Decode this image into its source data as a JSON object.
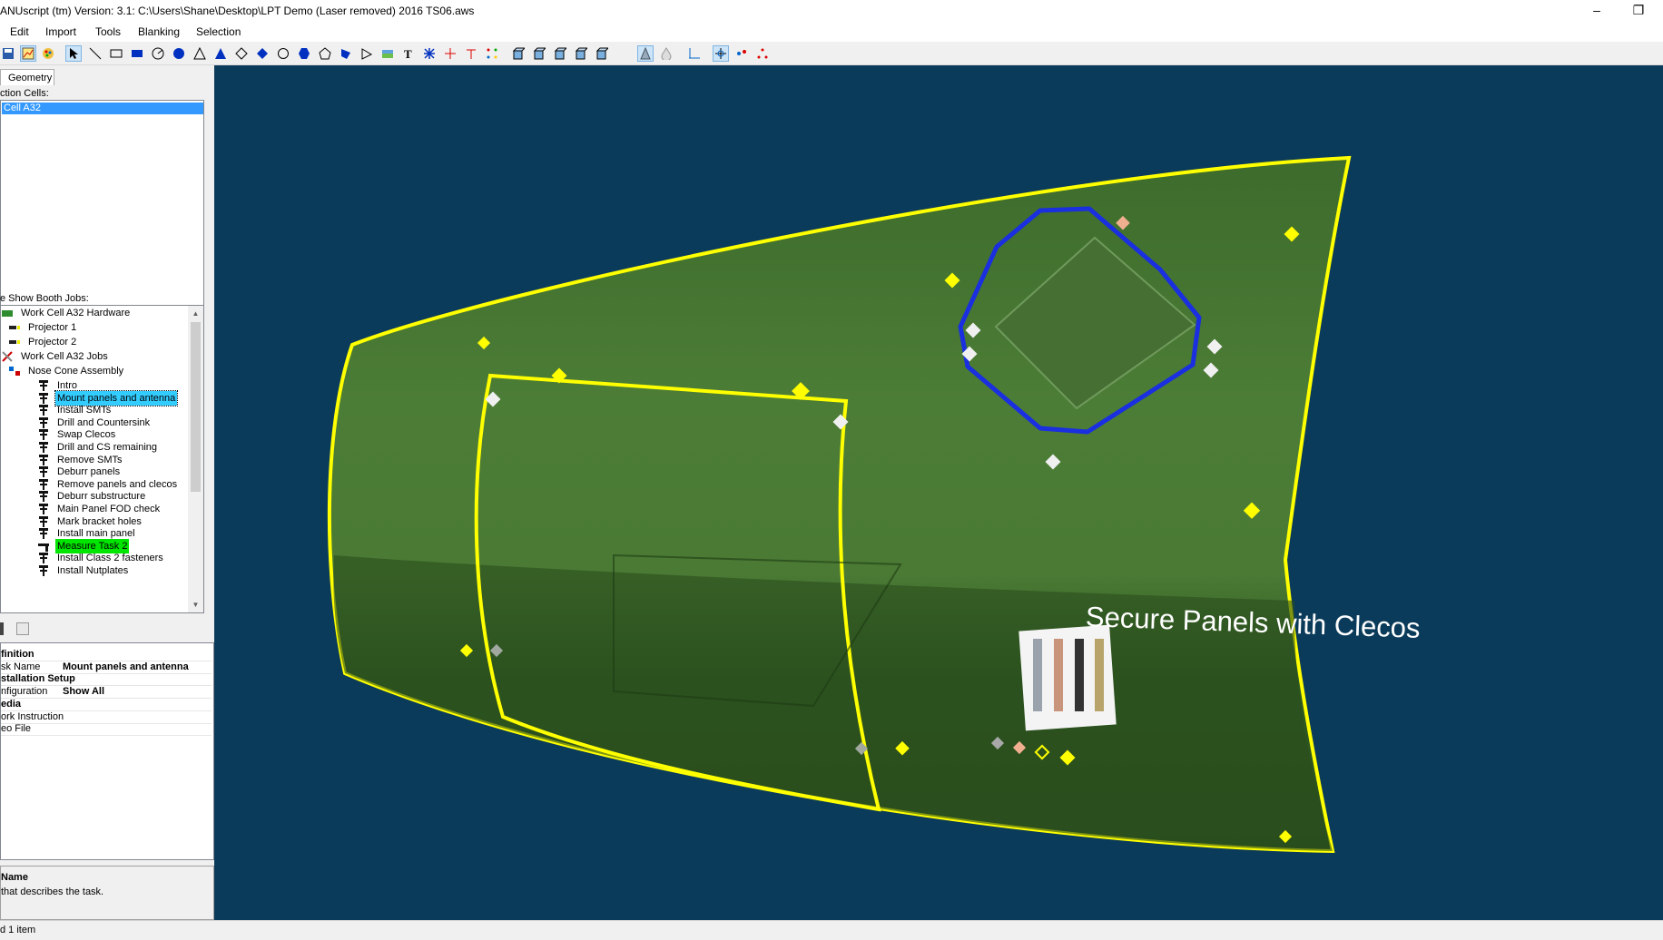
{
  "window": {
    "title": "ANUscript (tm) Version: 3.1: C:\\Users\\Shane\\Desktop\\LPT Demo (Laser removed) 2016 TS06.aws",
    "minimize": "–",
    "restore": "❐"
  },
  "menu": [
    "Edit",
    "Import",
    "Tools",
    "Blanking",
    "Selection"
  ],
  "left": {
    "tab": "Geometry",
    "cells_label": "ction Cells:",
    "cells": [
      "Cell A32"
    ],
    "jobs_label": "e Show Booth Jobs:",
    "tree": [
      {
        "label": "Work Cell A32 Hardware",
        "icon": "hardware-icon"
      },
      {
        "label": "Projector 1",
        "icon": "projector-icon"
      },
      {
        "label": "Projector 2",
        "icon": "projector-icon"
      },
      {
        "label": "Work Cell A32 Jobs",
        "icon": "tools-icon"
      },
      {
        "label": "Nose Cone Assembly",
        "icon": "assembly-icon"
      },
      {
        "label": "Intro",
        "icon": "task-icon"
      },
      {
        "label": "Mount panels and antenna",
        "icon": "task-icon",
        "state": "selected"
      },
      {
        "label": "Install SMTs",
        "icon": "task-icon"
      },
      {
        "label": "Drill and Countersink",
        "icon": "task-icon"
      },
      {
        "label": "Swap Clecos",
        "icon": "task-icon"
      },
      {
        "label": "Drill and CS remaining",
        "icon": "task-icon"
      },
      {
        "label": "Remove SMTs",
        "icon": "task-icon"
      },
      {
        "label": "Deburr panels",
        "icon": "task-icon"
      },
      {
        "label": "Remove panels and clecos",
        "icon": "task-icon"
      },
      {
        "label": "Deburr substructure",
        "icon": "task-icon"
      },
      {
        "label": "Main Panel FOD check",
        "icon": "task-icon"
      },
      {
        "label": "Mark bracket holes",
        "icon": "task-icon"
      },
      {
        "label": "Install main panel",
        "icon": "task-icon"
      },
      {
        "label": "Measure Task 2",
        "icon": "measure-icon",
        "state": "highlight"
      },
      {
        "label": "Install Class 2 fasteners",
        "icon": "task-icon"
      },
      {
        "label": "Install Nutplates",
        "icon": "task-icon"
      }
    ],
    "properties": [
      {
        "key": "finition",
        "value": "",
        "category": true
      },
      {
        "key": "sk Name",
        "value": "Mount panels and antenna",
        "category": false
      },
      {
        "key": "stallation Setup",
        "value": "",
        "category": true
      },
      {
        "key": "nfiguration",
        "value": "Show All",
        "category": false
      },
      {
        "key": "edia",
        "value": "",
        "category": true
      },
      {
        "key": "ork Instruction",
        "value": "",
        "category": false
      },
      {
        "key": "eo File",
        "value": "",
        "category": false
      }
    ],
    "description_title": "Name",
    "description_text": "that describes the task."
  },
  "viewport": {
    "background": "#0b3b5a",
    "overlay_text": "Secure Panels with Clecos"
  },
  "status": "d 1 item"
}
